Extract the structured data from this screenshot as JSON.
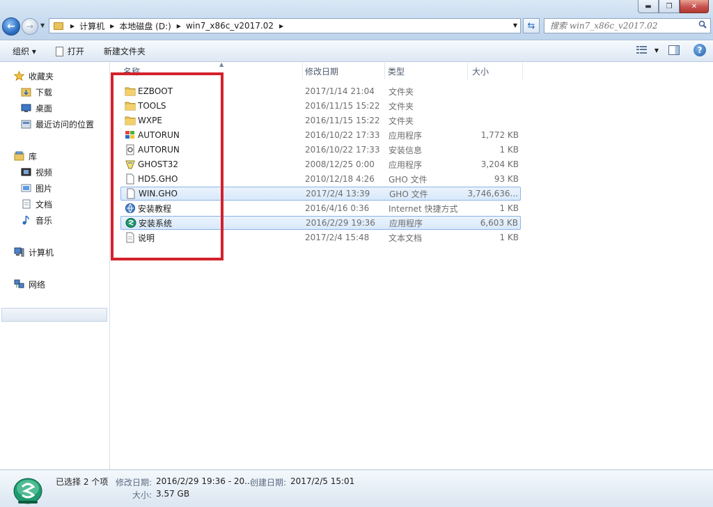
{
  "titlebar": {
    "minimize": "▬",
    "maximize": "❐",
    "close": "✕"
  },
  "nav": {
    "back": "←",
    "forward": "→"
  },
  "address": {
    "crumbs": [
      "计算机",
      "本地磁盘 (D:)",
      "win7_x86c_v2017.02"
    ]
  },
  "search": {
    "placeholder": "搜索 win7_x86c_v2017.02"
  },
  "toolbar": {
    "organize": "组织 ▾",
    "open": "打开",
    "new_folder": "新建文件夹"
  },
  "navpane": {
    "favorites": "收藏夹",
    "favorites_items": [
      "下载",
      "桌面",
      "最近访问的位置"
    ],
    "libraries": "库",
    "library_items": [
      "视频",
      "图片",
      "文档",
      "音乐"
    ],
    "computer": "计算机",
    "network": "网络"
  },
  "columns": {
    "name": "名称",
    "date": "修改日期",
    "type": "类型",
    "size": "大小"
  },
  "files": [
    {
      "name": "EZBOOT",
      "date": "2017/1/14 21:04",
      "type": "文件夹",
      "size": "",
      "icon": "folder-icon",
      "selected": false
    },
    {
      "name": "TOOLS",
      "date": "2016/11/15 15:22",
      "type": "文件夹",
      "size": "",
      "icon": "folder-icon",
      "selected": false
    },
    {
      "name": "WXPE",
      "date": "2016/11/15 15:22",
      "type": "文件夹",
      "size": "",
      "icon": "folder-icon",
      "selected": false
    },
    {
      "name": "AUTORUN",
      "date": "2016/10/22 17:33",
      "type": "应用程序",
      "size": "1,772 KB",
      "icon": "windows-app-icon",
      "selected": false
    },
    {
      "name": "AUTORUN",
      "date": "2016/10/22 17:33",
      "type": "安装信息",
      "size": "1 KB",
      "icon": "setup-info-icon",
      "selected": false
    },
    {
      "name": "GHOST32",
      "date": "2008/12/25 0:00",
      "type": "应用程序",
      "size": "3,204 KB",
      "icon": "ghost-icon",
      "selected": false
    },
    {
      "name": "HD5.GHO",
      "date": "2010/12/18 4:26",
      "type": "GHO 文件",
      "size": "93 KB",
      "icon": "file-icon",
      "selected": false
    },
    {
      "name": "WIN.GHO",
      "date": "2017/2/4 13:39",
      "type": "GHO 文件",
      "size": "3,746,636...",
      "icon": "file-icon",
      "selected": true
    },
    {
      "name": "安装教程",
      "date": "2016/4/16 0:36",
      "type": "Internet 快捷方式",
      "size": "1 KB",
      "icon": "internet-shortcut-icon",
      "selected": false
    },
    {
      "name": "安装系统",
      "date": "2016/2/29 19:36",
      "type": "应用程序",
      "size": "6,603 KB",
      "icon": "installer-icon",
      "selected": true
    },
    {
      "name": "说明",
      "date": "2017/2/4 15:48",
      "type": "文本文档",
      "size": "1 KB",
      "icon": "text-document-icon",
      "selected": false
    }
  ],
  "details": {
    "selected_count": "已选择 2 个项",
    "modified_label": "修改日期:",
    "modified_value": "2016/2/29 19:36 - 20...",
    "created_label": "创建日期:",
    "created_value": "2017/2/5 15:01",
    "size_label": "大小:",
    "size_value": "3.57 GB"
  },
  "colors": {
    "highlight_box": "#d4212b",
    "selection": "#d9e9fb",
    "selection_border": "#8bb4e6"
  }
}
